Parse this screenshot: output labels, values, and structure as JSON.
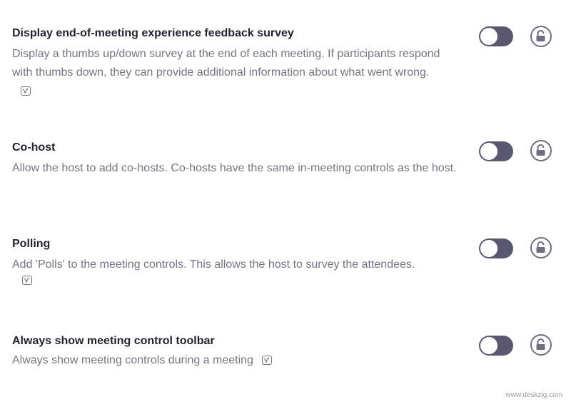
{
  "settings": [
    {
      "title": "Display end-of-meeting experience feedback survey",
      "description": "Display a thumbs up/down survey at the end of each meeting. If participants respond with thumbs down, they can provide additional information about what went wrong.",
      "toggle_on": false,
      "locked": false,
      "has_version_icon": true
    },
    {
      "title": "Co-host",
      "description": "Allow the host to add co-hosts. Co-hosts have the same in-meeting controls as the host.",
      "toggle_on": false,
      "locked": false,
      "has_version_icon": false
    },
    {
      "title": "Polling",
      "description": "Add 'Polls' to the meeting controls. This allows the host to survey the attendees.",
      "toggle_on": false,
      "locked": false,
      "has_version_icon": true
    },
    {
      "title": "Always show meeting control toolbar",
      "description": "Always show meeting controls during a meeting",
      "toggle_on": false,
      "locked": false,
      "has_version_icon": true
    }
  ],
  "watermark": "www.deskzig.com",
  "colors": {
    "toggle_off": "#585870",
    "title_text": "#232333",
    "description_text": "#747487",
    "lock_icon": "#6e6e85"
  },
  "icons": {
    "toggle": "toggle-switch",
    "lock": "unlocked-padlock-icon",
    "version": "version-info-icon"
  }
}
